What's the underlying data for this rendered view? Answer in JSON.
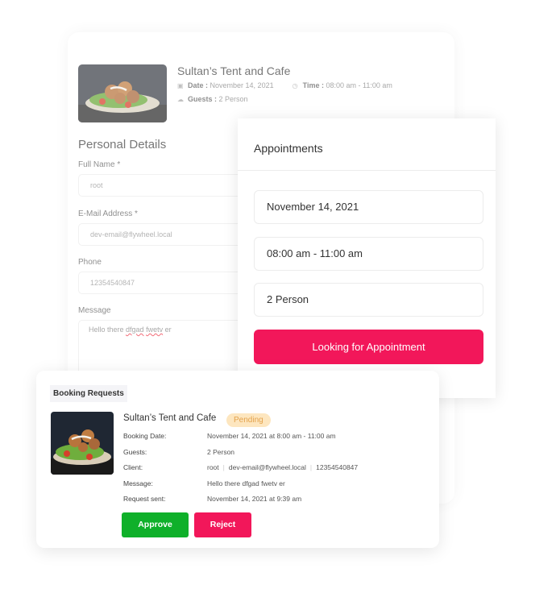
{
  "booking_form": {
    "restaurant_name": "Sultan’s Tent and Cafe",
    "date_label": "Date :",
    "date_value": "November 14, 2021",
    "time_label": "Time :",
    "time_value": "08:00 am - 11:00 am",
    "guests_label": "Guests :",
    "guests_value": "2 Person",
    "section_title": "Personal Details",
    "fields": {
      "full_name": {
        "label": "Full Name *",
        "value": "root"
      },
      "email": {
        "label": "E-Mail Address *",
        "value": "dev-email@flywheel.local"
      },
      "phone": {
        "label": "Phone",
        "value": "12354540847"
      },
      "message": {
        "label": "Message",
        "value_plain": "Hello there ",
        "value_typo1": "dfgad",
        "value_typo2": "fwetv",
        "value_end": " er"
      }
    },
    "icons": {
      "date": "calendar-icon",
      "time": "clock-icon",
      "guests": "guests-icon"
    }
  },
  "appointments": {
    "title": "Appointments",
    "date": "November 14, 2021",
    "time": "08:00 am - 11:00 am",
    "guests": "2 Person",
    "button_label": "Looking for Appointment",
    "accent_color": "#f2175a"
  },
  "booking_requests": {
    "title": "Booking Requests",
    "restaurant_name": "Sultan’s Tent and Cafe",
    "status": "Pending",
    "rows": [
      {
        "label": "Booking Date:",
        "value": "November 14, 2021 at 8:00 am - 11:00 am"
      },
      {
        "label": "Guests:",
        "value": "2 Person"
      },
      {
        "label": "Client:",
        "value": ""
      },
      {
        "label": "Message:",
        "value": "Hello there dfgad fwetv er"
      },
      {
        "label": "Request sent:",
        "value": "November 14, 2021 at 9:39 am"
      }
    ],
    "client": {
      "name": "root",
      "email": "dev-email@flywheel.local",
      "phone": "12354540847"
    },
    "approve_label": "Approve",
    "reject_label": "Reject",
    "colors": {
      "approve": "#0fb02a",
      "reject": "#f2175a",
      "pending_bg": "#fde6bf",
      "pending_text": "#e3a24c"
    }
  }
}
